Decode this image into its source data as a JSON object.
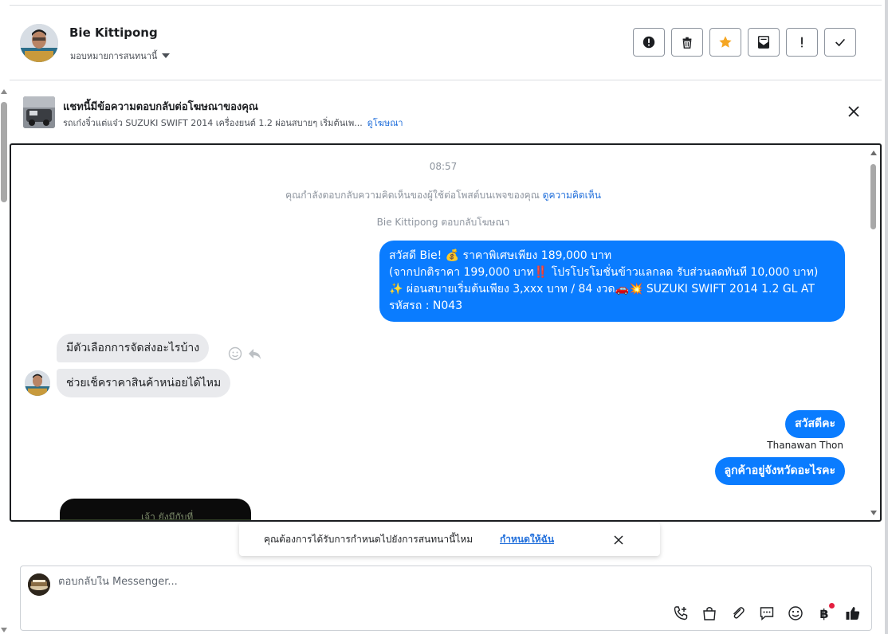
{
  "header": {
    "contact_name": "Bie Kittipong",
    "assign_label": "มอบหมายการสนทนานี้",
    "actions": [
      {
        "name": "report-spam-icon"
      },
      {
        "name": "trash-icon"
      },
      {
        "name": "star-icon",
        "color": "#f5a623"
      },
      {
        "name": "mark-unread-icon"
      },
      {
        "name": "exclamation-icon"
      },
      {
        "name": "checkmark-icon"
      }
    ]
  },
  "ad_banner": {
    "title": "แชทนี้มีข้อความตอบกลับต่อโฆษณาของคุณ",
    "subtitle": "รถเก๋งจิ๋วแต่แจ๋ว SUZUKI SWIFT 2014 เครื่องยนต์ 1.2 ผ่อนสบายๆ เริ่มต้นเพ...",
    "link": "ดูโฆษณา"
  },
  "chat": {
    "time": "08:57",
    "notice_text": "คุณกำลังตอบกลับความคิดเห็นของผู้ใช้ต่อโพสต์บนเพจของคุณ",
    "notice_link": "ดูความคิดเห็น",
    "replied_text": "Bie Kittipong ตอบกลับโฆษณา",
    "outgoing_ad_message": {
      "line1": "สวัสดี Bie! 💰 ราคาพิเศษเพียง 189,000 บาท",
      "line2": "(จากปกติราคา 199,000 บาท‼️ โปรโปรโมชั่นข้าวแลกลด รับส่วนลดทันที 10,000 บาท)",
      "line3": "✨ ผ่อนสบายเริ่มต้นเพียง 3,xxx บาท / 84 งวด🚗💥 SUZUKI SWIFT 2014 1.2 GL AT",
      "line4": " รหัสรถ : N043"
    },
    "incoming_1": "มีตัวเลือกการจัดส่งอะไรบ้าง",
    "incoming_2": "ช่วยเช็คราคาสินค้าหน่อยได้ไหม",
    "outgoing_2": "สวัสดีคะ",
    "sender_name": "Thanawan Thon",
    "outgoing_3": "ลูกค้าอยู่จังหวัดอะไรคะ",
    "media_caption": "เจ้า ยังมีกับที่"
  },
  "toast": {
    "text": "คุณต้องการได้รับการกำหนดไปยังการสนทนานี้ไหม",
    "link": "กำหนดให้ฉัน"
  },
  "composer": {
    "placeholder": "ตอบกลับใน Messenger...",
    "tools": [
      "phone-add-icon",
      "shopping-bag-icon",
      "paperclip-icon",
      "saved-reply-icon",
      "emoji-icon",
      "baht-payment-icon",
      "like-icon"
    ],
    "baht_symbol": "฿"
  },
  "colors": {
    "accent": "#0a7cff",
    "link": "#216fdb",
    "bubble_in": "#e9eaed"
  }
}
